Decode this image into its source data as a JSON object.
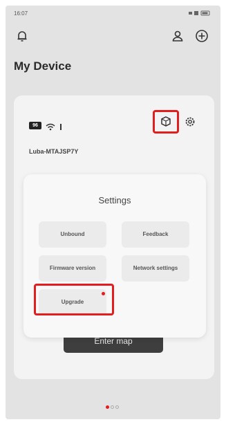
{
  "status_bar": {
    "time": "16:07",
    "right": ""
  },
  "page": {
    "title": "My Device"
  },
  "device": {
    "battery": "96",
    "name": "Luba-MTAJSP7Y"
  },
  "settings": {
    "title": "Settings",
    "options": [
      "Unbound",
      "Feedback",
      "Firmware version",
      "Network settings",
      "Upgrade"
    ]
  },
  "enter_map_label": "Enter map",
  "colors": {
    "highlight": "#e21d1d",
    "page_dot_active": "#e21d1d"
  }
}
